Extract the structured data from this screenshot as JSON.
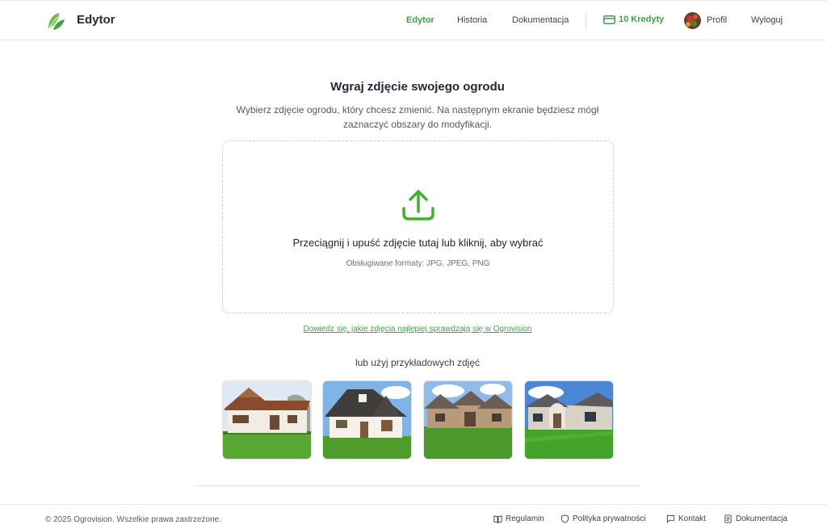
{
  "header": {
    "brand": "Edytor",
    "nav": {
      "editor": "Edytor",
      "history": "Historia",
      "docs": "Dokumentacja"
    },
    "credits": "10 Kredyty",
    "profile": "Profil",
    "logout": "Wyloguj",
    "accent_color": "#43a047"
  },
  "main": {
    "title": "Wgraj zdjęcie swojego ogrodu",
    "subtitle": "Wybierz zdjęcie ogrodu, który chcesz zmienić. Na następnym ekranie będziesz mógł zaznaczyć obszary do modyfikacji.",
    "dropzone": {
      "main_text": "Przeciągnij i upuść zdjęcie tutaj lub kliknij, aby wybrać",
      "formats": "Obsługiwane formaty: JPG, JPEG, PNG",
      "icon": "upload-icon"
    },
    "help_link": "Dowiedz się, jakie zdjęcia najlepiej sprawdzają się w Ogrovision",
    "examples_label": "lub użyj przykładowych zdjęć",
    "examples": [
      {
        "icon": "house-photo-1"
      },
      {
        "icon": "house-photo-2"
      },
      {
        "icon": "house-photo-3"
      },
      {
        "icon": "house-photo-4"
      }
    ]
  },
  "footer": {
    "copyright": "© 2025 Ogrovision. Wszelkie prawa zastrzeżone.",
    "links": {
      "terms": "Regulamin",
      "privacy": "Polityka prywatności",
      "contact": "Kontakt",
      "docs": "Dokumentacja"
    }
  }
}
